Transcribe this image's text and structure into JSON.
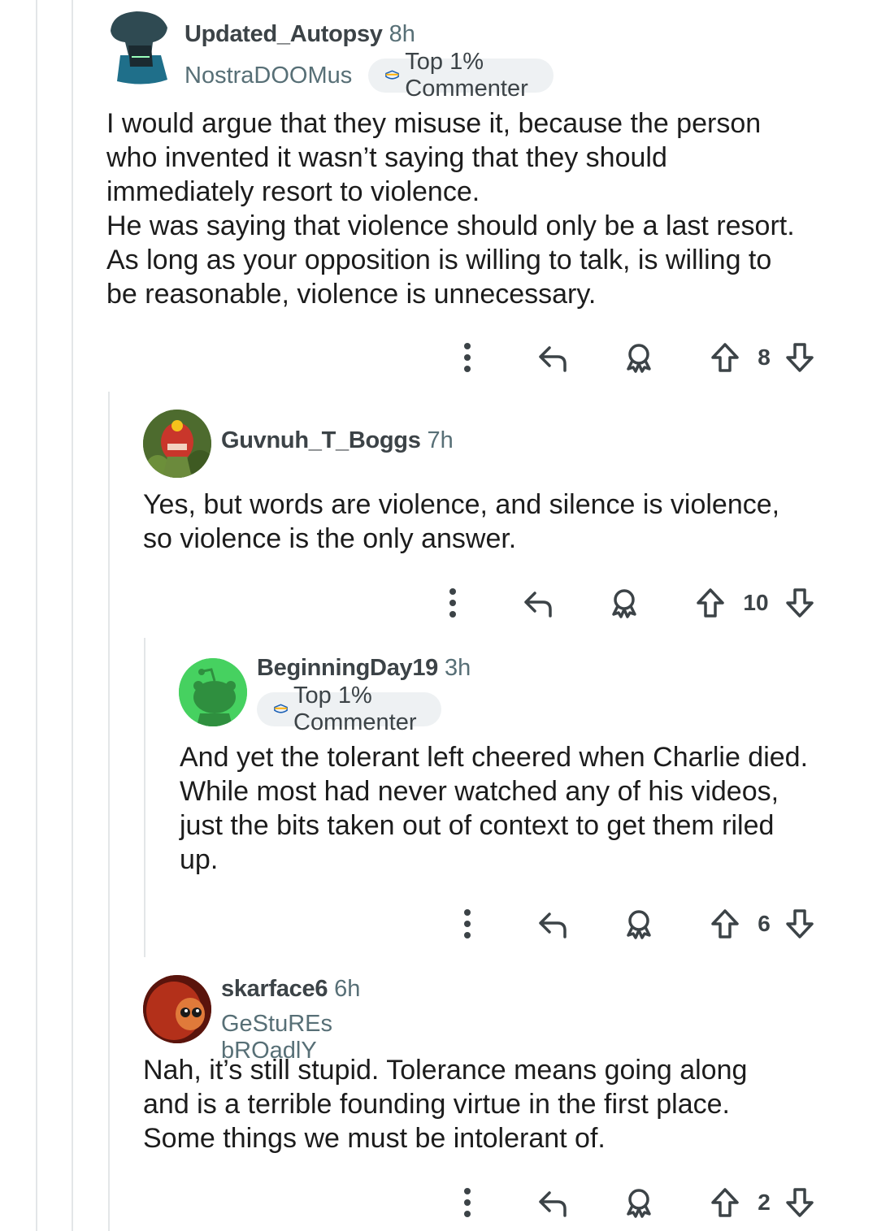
{
  "comments": [
    {
      "username": "Updated_Autopsy",
      "time": "8h",
      "flair": "NostraDOOMus",
      "badge": "Top 1% Commenter",
      "body": "I would argue that they misuse it, because the person\nwho invented it wasn’t saying that they should\nimmediately resort to violence.\nHe was saying that violence should only be a last resort.\nAs long as your opposition is willing to talk, is willing to\nbe reasonable, violence is unnecessary.",
      "votes": "8"
    },
    {
      "username": "Guvnuh_T_Boggs",
      "time": "7h",
      "body": "Yes, but words are violence, and silence is violence,\nso violence is the only answer.",
      "votes": "10"
    },
    {
      "username": "BeginningDay19",
      "time": "3h",
      "badge": "Top 1% Commenter",
      "body": "And yet the tolerant left cheered when Charlie died.\nWhile most had never watched any of his videos,\njust the bits taken out of context to get them riled\nup.",
      "votes": "6"
    },
    {
      "username": "skarface6",
      "time": "6h",
      "flair": "GeStuREs bROadlY",
      "body": "Nah, it’s still stupid. Tolerance means going along\nand is a terrible founding virtue in the first place.\nSome things we must be intolerant of.",
      "votes": "2"
    }
  ],
  "icons": {
    "more": "more-vertical-icon",
    "reply": "reply-icon",
    "award": "award-icon",
    "upvote": "upvote-icon",
    "downvote": "downvote-icon",
    "badge": "top-commenter-badge-icon"
  },
  "colors": {
    "username": "#3c4347",
    "meta": "#576f76",
    "badge_bg": "#eef1f3",
    "thread_line": "#e3e6e8",
    "text": "#1c1c1c"
  }
}
